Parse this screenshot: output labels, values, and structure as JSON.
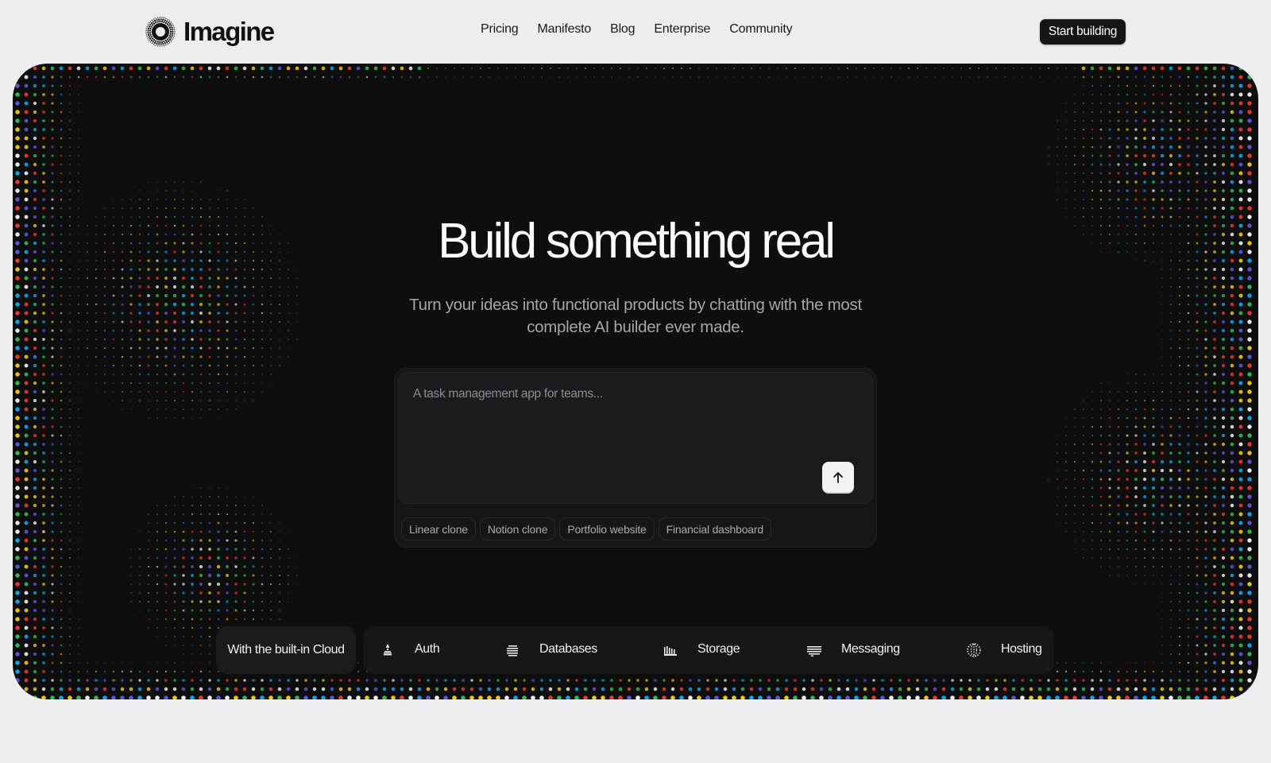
{
  "brand": {
    "name": "Imagine",
    "logo_icon": "halftone-circle-logo-icon"
  },
  "nav": {
    "links": [
      "Pricing",
      "Manifesto",
      "Blog",
      "Enterprise",
      "Community"
    ],
    "cta_label": "Start building"
  },
  "hero": {
    "headline": "Build something real",
    "subheadline": "Turn your ideas into functional products by chatting with the most complete AI builder ever made.",
    "background_pattern": "rainbow-halftone-dots"
  },
  "prompt": {
    "placeholder": "A task management app for teams...",
    "value": "",
    "send_icon": "arrow-up-icon",
    "suggestions": [
      "Linear clone",
      "Notion clone",
      "Portfolio website",
      "Financial dashboard"
    ]
  },
  "features": {
    "intro_label": "With the built-in Cloud",
    "items": [
      {
        "label": "Auth",
        "icon": "auth-icon"
      },
      {
        "label": "Databases",
        "icon": "databases-icon"
      },
      {
        "label": "Storage",
        "icon": "storage-icon"
      },
      {
        "label": "Messaging",
        "icon": "messaging-icon"
      },
      {
        "label": "Hosting",
        "icon": "hosting-icon"
      }
    ]
  },
  "colors": {
    "page_bg": "#ededef",
    "hero_bg": "#0e0e0f",
    "cta_bg": "#151515",
    "headline": "#fbfbfb",
    "subhead": "#a5a5aa"
  }
}
